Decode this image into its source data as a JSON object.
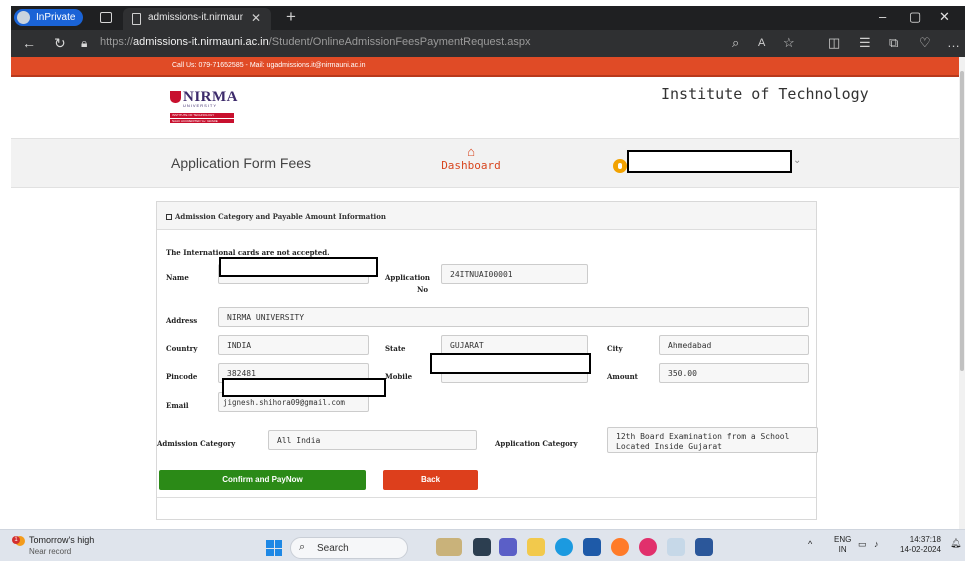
{
  "browser": {
    "inprivate_label": "InPrivate",
    "tab_title": "admissions-it.nirmauni.ac.in/Stuc",
    "url_prefix": "https://",
    "url_domain": "admissions-it.nirmauni.ac.in",
    "url_path": "/Student/OnlineAdmissionFeesPaymentRequest.aspx"
  },
  "site": {
    "topbar_text": "Call Us: 079-71652585 - Mail: ugadmissions.it@nirmauni.ac.in",
    "logo_name": "NIRMA",
    "logo_sub": "UNIVERSITY",
    "logo_band": "INSTITUTE OF TECHNOLOGY",
    "logo_band2": "NAAC ACCREDITED 'A+' GRADE",
    "institute": "Institute of Technology",
    "page_title": "Application Form Fees",
    "dashboard_label": "Dashboard"
  },
  "panel": {
    "heading": "Admission Category and Payable Amount Information",
    "note": "The International cards are not accepted.",
    "labels": {
      "name": "Name",
      "application_no_1": "Application",
      "application_no_2": "No",
      "address": "Address",
      "country": "Country",
      "state": "State",
      "city": "City",
      "pincode": "Pincode",
      "mobile": "Mobile",
      "amount": "Amount",
      "email": "Email",
      "admission_category": "Admission Category",
      "application_category": "Application Category"
    },
    "values": {
      "application_no": "24ITNUAI00001",
      "address": "NIRMA UNIVERSITY",
      "country": "INDIA",
      "state": "GUJARAT",
      "city": "Ahmedabad",
      "pincode": "382481",
      "amount": "350.00",
      "email": "jignesh.shihora09@gmail.com",
      "admission_category": "All India",
      "application_category": "12th Board Examination from a School Located Inside Gujarat"
    },
    "confirm_button": "Confirm and PayNow",
    "back_button": "Back"
  },
  "taskbar": {
    "weather_line1": "Tomorrow's high",
    "weather_line2": "Near record",
    "weather_badge": "1",
    "search_label": "Search",
    "lang_1": "ENG",
    "lang_2": "IN",
    "time": "14:37:18",
    "date": "14-02-2024"
  },
  "colors": {
    "accent_orange": "#e04b26",
    "confirm_green": "#2b8a17",
    "back_red": "#dd3f1c",
    "inprivate_blue": "#1a63d6"
  }
}
